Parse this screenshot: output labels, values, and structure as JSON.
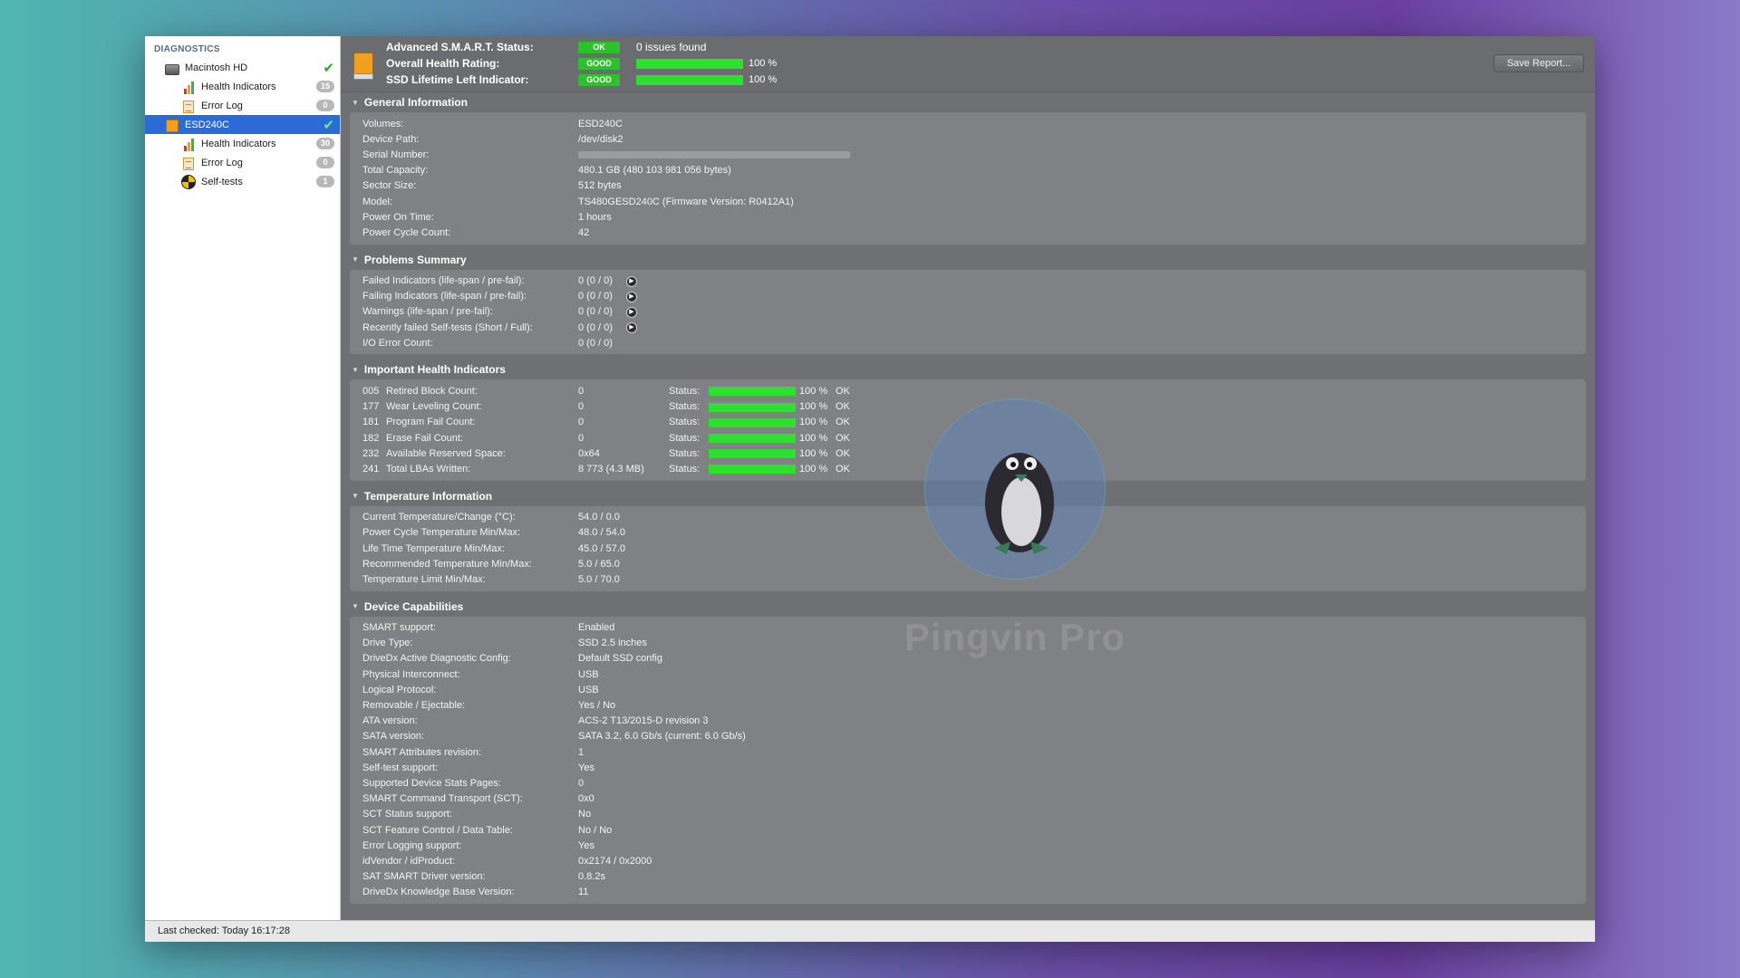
{
  "sidebar": {
    "header": "DIAGNOSTICS",
    "items": [
      {
        "label": "Macintosh HD",
        "badge": "",
        "check": "✔"
      },
      {
        "label": "Health Indicators",
        "badge": "15"
      },
      {
        "label": "Error Log",
        "badge": "0"
      },
      {
        "label": "ESD240C",
        "badge": "",
        "check": "✔"
      },
      {
        "label": "Health Indicators",
        "badge": "30"
      },
      {
        "label": "Error Log",
        "badge": "0"
      },
      {
        "label": "Self-tests",
        "badge": "1"
      }
    ]
  },
  "summary": {
    "smart_label": "Advanced S.M.A.R.T. Status:",
    "smart_pill": "OK",
    "smart_text": "0 issues found",
    "health_label": "Overall Health Rating:",
    "health_pill": "GOOD",
    "health_pct": "100 %",
    "health_value": 1.0,
    "lifetime_label": "SSD Lifetime Left Indicator:",
    "lifetime_pill": "GOOD",
    "lifetime_pct": "100 %",
    "lifetime_value": 1.0,
    "save_button": "Save Report..."
  },
  "colors": {
    "ok_green": "#2ec02e",
    "selection_blue": "#2a6bd6"
  },
  "general": {
    "title": "General Information",
    "rows": [
      {
        "k": "Volumes:",
        "v": "ESD240C"
      },
      {
        "k": "Device Path:",
        "v": "/dev/disk2"
      },
      {
        "k": "Serial Number:",
        "v": ""
      },
      {
        "k": "Total Capacity:",
        "v": "480.1 GB (480 103 981 056 bytes)"
      },
      {
        "k": "Sector Size:",
        "v": "512 bytes"
      },
      {
        "k": "Model:",
        "v": "TS480GESD240C  (Firmware Version: R0412A1)"
      },
      {
        "k": "Power On Time:",
        "v": "1 hours"
      },
      {
        "k": "Power Cycle Count:",
        "v": "42"
      }
    ]
  },
  "problems": {
    "title": "Problems Summary",
    "rows": [
      {
        "k": "Failed Indicators (life-span / pre-fail):",
        "v": "0 (0 / 0)"
      },
      {
        "k": "Failing Indicators (life-span / pre-fail):",
        "v": "0 (0 / 0)"
      },
      {
        "k": "Warnings (life-span / pre-fail):",
        "v": "0 (0 / 0)"
      },
      {
        "k": "Recently failed Self-tests (Short / Full):",
        "v": "0 (0 / 0)"
      },
      {
        "k": "I/O Error Count:",
        "v": "0 (0 / 0)"
      }
    ]
  },
  "health": {
    "title": "Important Health Indicators",
    "status_label": "Status:",
    "rows": [
      {
        "num": "005",
        "name": "Retired Block Count:",
        "val": "0",
        "pct": "100 %",
        "ok": "OK",
        "level": 1.0
      },
      {
        "num": "177",
        "name": "Wear Leveling Count:",
        "val": "0",
        "pct": "100 %",
        "ok": "OK",
        "level": 1.0
      },
      {
        "num": "181",
        "name": "Program Fail Count:",
        "val": "0",
        "pct": "100 %",
        "ok": "OK",
        "level": 1.0
      },
      {
        "num": "182",
        "name": "Erase Fail Count:",
        "val": "0",
        "pct": "100 %",
        "ok": "OK",
        "level": 1.0
      },
      {
        "num": "232",
        "name": "Available Reserved Space:",
        "val": "0x64",
        "pct": "100 %",
        "ok": "OK",
        "level": 1.0
      },
      {
        "num": "241",
        "name": "Total LBAs Written:",
        "val": "8 773 (4.3 MB)",
        "pct": "100 %",
        "ok": "OK",
        "level": 1.0
      }
    ]
  },
  "temperature": {
    "title": "Temperature Information",
    "rows": [
      {
        "k": "Current Temperature/Change (°C):",
        "v": "54.0 / 0.0"
      },
      {
        "k": "Power Cycle Temperature Min/Max:",
        "v": "48.0 / 54.0"
      },
      {
        "k": "Life Time Temperature Min/Max:",
        "v": "45.0 / 57.0"
      },
      {
        "k": "Recommended Temperature Min/Max:",
        "v": "5.0   / 65.0"
      },
      {
        "k": "Temperature Limit Min/Max:",
        "v": "5.0   / 70.0"
      }
    ]
  },
  "capabilities": {
    "title": "Device Capabilities",
    "rows": [
      {
        "k": "SMART support:",
        "v": "Enabled"
      },
      {
        "k": "Drive Type:",
        "v": "SSD 2.5 inches"
      },
      {
        "k": "DriveDx Active Diagnostic Config:",
        "v": "Default SSD config"
      },
      {
        "k": "Physical Interconnect:",
        "v": "USB"
      },
      {
        "k": "Logical Protocol:",
        "v": "USB"
      },
      {
        "k": "Removable / Ejectable:",
        "v": "Yes / No"
      },
      {
        "k": "ATA version:",
        "v": "ACS-2 T13/2015-D revision 3"
      },
      {
        "k": "SATA version:",
        "v": "SATA 3.2, 6.0 Gb/s (current: 6.0 Gb/s)"
      },
      {
        "k": "SMART Attributes revision:",
        "v": "1"
      },
      {
        "k": "Self-test support:",
        "v": "Yes"
      },
      {
        "k": "Supported Device Stats Pages:",
        "v": "0"
      },
      {
        "k": "SMART Command Transport (SCT):",
        "v": "0x0"
      },
      {
        "k": "SCT Status support:",
        "v": "No"
      },
      {
        "k": "SCT Feature Control / Data Table:",
        "v": "No / No"
      },
      {
        "k": "Error Logging support:",
        "v": "Yes"
      },
      {
        "k": "idVendor / idProduct:",
        "v": "0x2174 / 0x2000"
      },
      {
        "k": "SAT SMART Driver version:",
        "v": "0.8.2s"
      },
      {
        "k": "DriveDx Knowledge Base Version:",
        "v": "11"
      }
    ]
  },
  "statusbar": {
    "text": "Last checked: Today 16:17:28"
  },
  "watermark": {
    "text": "Pingvin Pro"
  }
}
